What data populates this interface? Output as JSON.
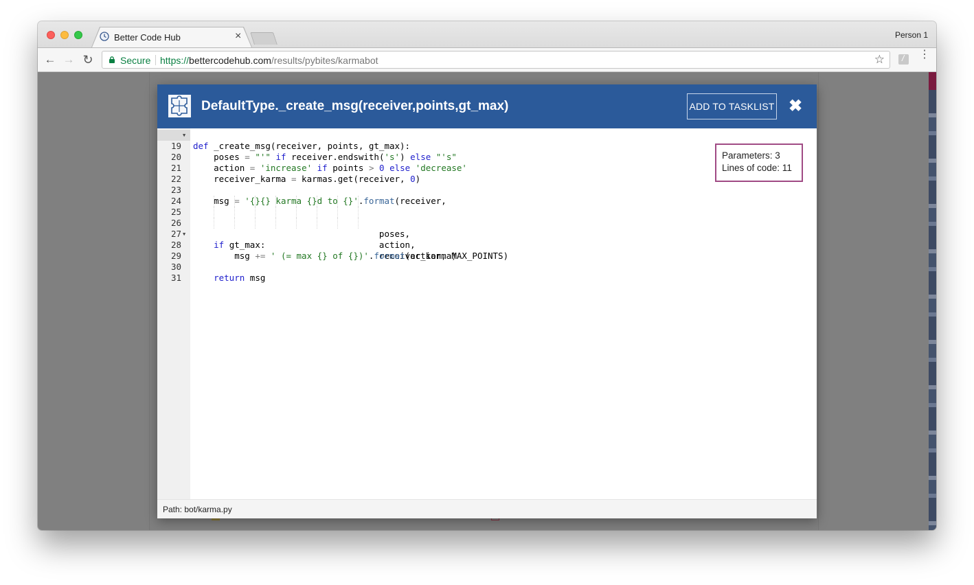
{
  "browser": {
    "tab_title": "Better Code Hub",
    "profile_name": "Person 1",
    "secure_label": "Secure",
    "url_scheme": "https://",
    "url_host": "bettercodehub.com",
    "url_path": "/results/pybites/karmabot"
  },
  "modal": {
    "title": "DefaultType._create_msg(receiver,points,gt_max)",
    "add_button_label": "ADD TO TASKLIST",
    "close_symbol": "✖",
    "metrics": {
      "parameters": "Parameters: 3",
      "lines_of_code": "Lines of code: 11"
    },
    "footer_path": "Path: bot/karma.py"
  },
  "code_lines": [
    {
      "number": "19",
      "foldable": true
    },
    {
      "number": "20",
      "foldable": false
    },
    {
      "number": "21",
      "foldable": false
    },
    {
      "number": "22",
      "foldable": false
    },
    {
      "number": "23",
      "foldable": false
    },
    {
      "number": "24",
      "foldable": false
    },
    {
      "number": "25",
      "foldable": false
    },
    {
      "number": "26",
      "foldable": false
    },
    {
      "number": "27",
      "foldable": false
    },
    {
      "number": "28",
      "foldable": true
    },
    {
      "number": "29",
      "foldable": false
    },
    {
      "number": "30",
      "foldable": false
    },
    {
      "number": "31",
      "foldable": false
    }
  ],
  "colors": {
    "header_blue": "#2b5a9a",
    "metrics_border": "#a04a84",
    "secure_green": "#0b8043",
    "keyword": "#1e1ecc",
    "string": "#237823"
  },
  "icons": [
    "clock-favicon-icon",
    "lock-icon",
    "back-arrow-icon",
    "forward-arrow-icon",
    "reload-icon",
    "star-icon",
    "extension-icon",
    "menu-dots-icon",
    "puzzle-icon",
    "close-icon",
    "fold-arrow-icon"
  ]
}
